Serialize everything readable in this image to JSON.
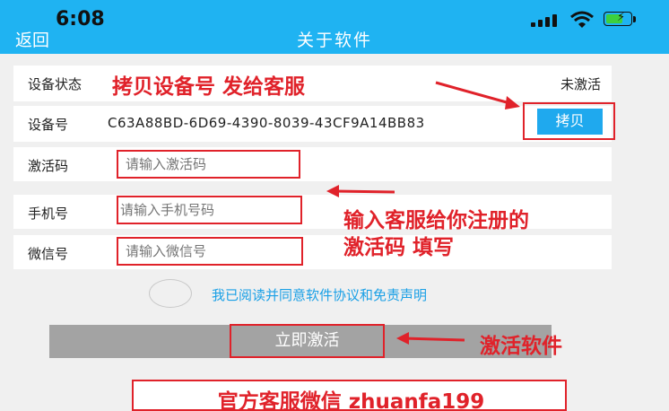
{
  "status_bar": {
    "time": "6:08"
  },
  "nav": {
    "back_label": "返回",
    "title": "关于软件"
  },
  "device_status": {
    "label": "设备状态",
    "value": "未激活"
  },
  "device_id": {
    "label": "设备号",
    "value": "C63A88BD-6D69-4390-8039-43CF9A14BB83",
    "copy_label": "拷贝"
  },
  "activation_code": {
    "label": "激活码",
    "placeholder": "请输入激活码"
  },
  "phone": {
    "label": "手机号",
    "placeholder": "请输入手机号码"
  },
  "wechat": {
    "label": "微信号",
    "placeholder": "请输入微信号"
  },
  "agreement": {
    "text": "我已阅读并同意软件协议和免责声明"
  },
  "activate_button": {
    "label": "立即激活"
  },
  "annotations": {
    "copy_note": "拷贝设备号 发给客服",
    "fill_note_line1": "输入客服给你注册的",
    "fill_note_line2": "激活码 填写",
    "activate_note": "激活软件",
    "official_wechat": "官方客服微信 zhuanfa199"
  },
  "colors": {
    "nav_bg": "#1fb3f2",
    "annotation_red": "#e0222a",
    "agree_text": "#1aa0e6",
    "copy_button": "#1fa9ee"
  }
}
